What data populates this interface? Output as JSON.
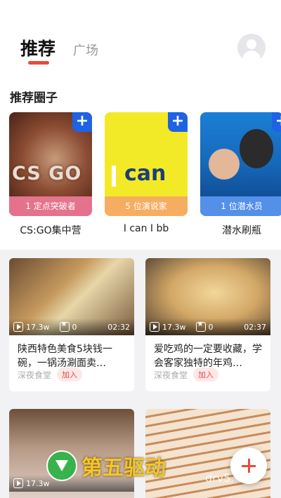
{
  "header": {
    "tab_recommended": "推荐",
    "tab_square": "广场",
    "avatar_icon": "user-avatar-icon"
  },
  "circles_section": {
    "title": "推荐圈子",
    "items": [
      {
        "name": "CS:GO集中营",
        "members": "1 定点突破者",
        "thumb_text": "CS GO"
      },
      {
        "name": "I can I bb",
        "members": "5 位演说家",
        "thumb_text": "can"
      },
      {
        "name": "潜水刷瓶",
        "members": "1 位潜水员",
        "thumb_text": ""
      }
    ]
  },
  "feed": [
    {
      "title": "陕西特色美食5块钱一碗，一锅汤涮面卖…",
      "views": "17.3w",
      "stars": "0",
      "duration": "02:32",
      "circle": "深夜食堂",
      "join": "加入"
    },
    {
      "title": "爱吃鸡的一定要收藏，学会客家独特的年鸡…",
      "views": "17.3w",
      "stars": "0",
      "duration": "02:37",
      "circle": "深夜食堂",
      "join": "加入"
    },
    {
      "title": "",
      "views": "17.3w",
      "stars": "",
      "duration": "",
      "circle": "",
      "join": ""
    },
    {
      "title": "",
      "views": "",
      "stars": "",
      "duration": "",
      "circle": "",
      "join": ""
    }
  ],
  "watermark": {
    "brand": "第五驱动",
    "url": "drv5.cn"
  },
  "colors": {
    "accent": "#e64d3c",
    "plus_blue": "#1e63e5",
    "join_red": "#e6484d"
  }
}
